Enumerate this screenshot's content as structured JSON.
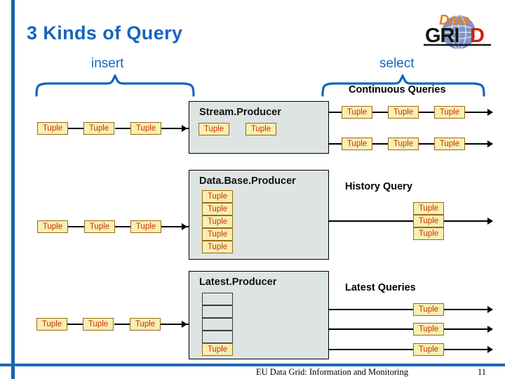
{
  "slide": {
    "title": "3 Kinds of Query",
    "accent_color": "#1565bd",
    "tuple_fill": "#f6efb4",
    "tuple_text_color": "#cc3300",
    "producer_fill": "#dde4e2"
  },
  "logo": {
    "word_top": "Data",
    "word_bottom": "GRID",
    "word_top_color": "#f07d1a",
    "word_bottom_color": "#1a1a1a",
    "accent_letter_color": "#cc2200",
    "globe_color": "#6b86c4"
  },
  "braces": {
    "insert_label": "insert",
    "select_label": "select"
  },
  "headings": {
    "continuous_queries": "Continuous Queries",
    "history_query": "History Query",
    "latest_queries": "Latest Queries"
  },
  "producers": [
    {
      "id": "stream",
      "name": "Stream.Producer",
      "tuples": [
        "Tuple",
        "Tuple"
      ]
    },
    {
      "id": "database",
      "name": "Data.Base.Producer",
      "tuples": [
        "Tuple",
        "Tuple",
        "Tuple",
        "Tuple",
        "Tuple"
      ]
    },
    {
      "id": "latest",
      "name": "Latest.Producer",
      "tuples": [
        "",
        "",
        "",
        "",
        "Tuple"
      ]
    }
  ],
  "insert_streams": [
    {
      "row": 1,
      "tuples": [
        "Tuple",
        "Tuple",
        "Tuple"
      ]
    },
    {
      "row": 2,
      "tuples": [
        "Tuple",
        "Tuple",
        "Tuple"
      ]
    },
    {
      "row": 3,
      "tuples": [
        "Tuple",
        "Tuple",
        "Tuple"
      ]
    }
  ],
  "continuous_query_rows": [
    {
      "row": 1,
      "tuples": [
        "Tuple",
        "Tuple",
        "Tuple"
      ]
    },
    {
      "row": 2,
      "tuples": [
        "Tuple",
        "Tuple",
        "Tuple"
      ]
    }
  ],
  "history_query_stack": [
    "Tuple",
    "Tuple",
    "Tuple"
  ],
  "latest_query_rows": [
    {
      "row": 1,
      "tuples": [
        "Tuple"
      ]
    },
    {
      "row": 2,
      "tuples": [
        "Tuple"
      ]
    },
    {
      "row": 3,
      "tuples": [
        "Tuple"
      ]
    }
  ],
  "footer": {
    "text": "EU Data Grid:  Information and Monitoring",
    "page": "11"
  }
}
